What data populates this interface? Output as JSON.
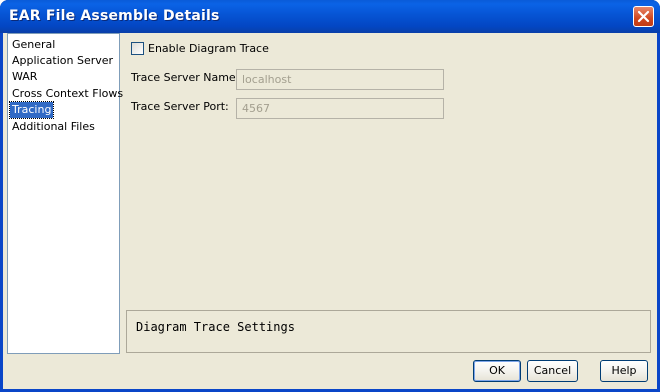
{
  "window": {
    "title": "EAR File Assemble Details"
  },
  "sidebar": {
    "items": [
      {
        "label": "General"
      },
      {
        "label": "Application Server"
      },
      {
        "label": "WAR"
      },
      {
        "label": "Cross Context Flows"
      },
      {
        "label": "Tracing",
        "selected": true
      },
      {
        "label": "Additional Files"
      }
    ]
  },
  "tracing": {
    "enable_label": "Enable Diagram Trace",
    "enable_checked": false,
    "server_name_label": "Trace Server Name:",
    "server_name_value": "localhost",
    "server_port_label": "Trace Server Port:",
    "server_port_value": "4567"
  },
  "description": {
    "text": "Diagram Trace Settings"
  },
  "buttons": {
    "ok": "OK",
    "cancel": "Cancel",
    "help": "Help"
  },
  "colors": {
    "title_bar": "#0654d4",
    "selection": "#316ac5",
    "dialog_bg": "#ece9d8",
    "close_button": "#d0471f"
  },
  "icons": {
    "close": "close-icon"
  }
}
